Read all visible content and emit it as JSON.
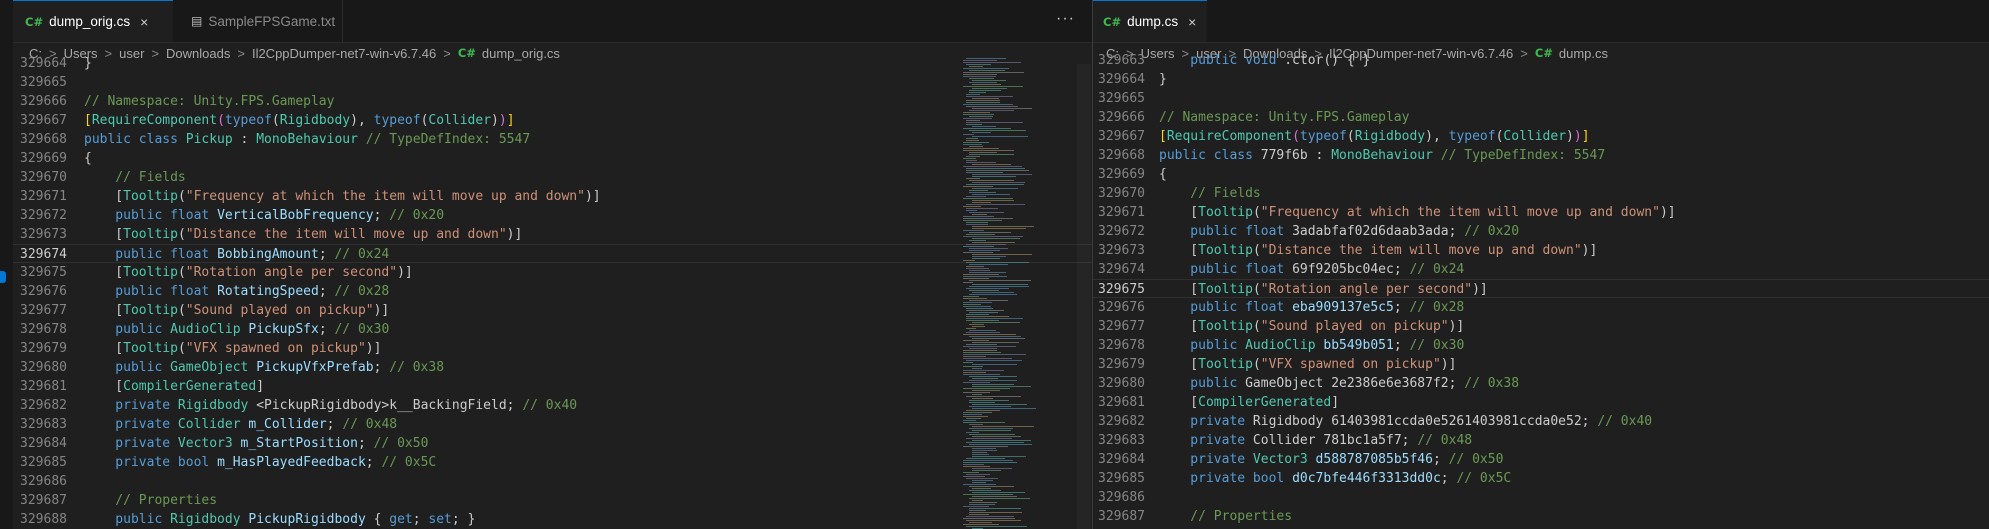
{
  "left": {
    "tabs": [
      {
        "label": "dump_orig.cs",
        "icon": "C#",
        "active": true,
        "close": "×"
      },
      {
        "label": "SampleFPSGame.txt",
        "icon": "file-icon",
        "active": false
      }
    ],
    "more": "···",
    "breadcrumb": [
      "C:",
      "Users",
      "user",
      "Downloads",
      "Il2CppDumper-net7-win-v6.7.46",
      "dump_orig.cs"
    ],
    "breadcrumb_sep": ">",
    "breadcrumb_icon": "C#",
    "current_line": "329674",
    "lines": [
      {
        "n": "329664",
        "t": [
          [
            "}",
            "pl"
          ]
        ]
      },
      {
        "n": "329665",
        "t": []
      },
      {
        "n": "329666",
        "t": [
          [
            "// Namespace: Unity.FPS.Gameplay",
            "cm"
          ]
        ]
      },
      {
        "n": "329667",
        "t": [
          [
            "[",
            "br"
          ],
          [
            "RequireComponent",
            "ty"
          ],
          [
            "(",
            "br2"
          ],
          [
            "typeof",
            "kw"
          ],
          [
            "(",
            "pl"
          ],
          [
            "Rigidbody",
            "ty"
          ],
          [
            "), ",
            "pl"
          ],
          [
            "typeof",
            "kw"
          ],
          [
            "(",
            "pl"
          ],
          [
            "Collider",
            "ty"
          ],
          [
            ")",
            "pl"
          ],
          [
            ")",
            "br2"
          ],
          [
            "]",
            "br"
          ]
        ]
      },
      {
        "n": "329668",
        "t": [
          [
            "public class ",
            "kw"
          ],
          [
            "Pickup",
            "ty"
          ],
          [
            " : ",
            "pl"
          ],
          [
            "MonoBehaviour",
            "ty"
          ],
          [
            " // TypeDefIndex: 5547",
            "cm"
          ]
        ]
      },
      {
        "n": "329669",
        "t": [
          [
            "{",
            "pl"
          ]
        ]
      },
      {
        "n": "329670",
        "t": [
          [
            "    // Fields",
            "cm"
          ]
        ]
      },
      {
        "n": "329671",
        "t": [
          [
            "    [",
            "pl"
          ],
          [
            "Tooltip",
            "ty"
          ],
          [
            "(",
            "pl"
          ],
          [
            "\"Frequency at which the item will move up and down\"",
            "st"
          ],
          [
            ")]",
            "pl"
          ]
        ]
      },
      {
        "n": "329672",
        "t": [
          [
            "    public float ",
            "kw"
          ],
          [
            "VerticalBobFrequency",
            "id"
          ],
          [
            "; ",
            "pl"
          ],
          [
            "// 0x20",
            "cm"
          ]
        ]
      },
      {
        "n": "329673",
        "t": [
          [
            "    [",
            "pl"
          ],
          [
            "Tooltip",
            "ty"
          ],
          [
            "(",
            "pl"
          ],
          [
            "\"Distance the item will move up and down\"",
            "st"
          ],
          [
            ")]",
            "pl"
          ]
        ]
      },
      {
        "n": "329674",
        "t": [
          [
            "    public float ",
            "kw"
          ],
          [
            "BobbingAmount",
            "id"
          ],
          [
            "; ",
            "pl"
          ],
          [
            "// 0x24",
            "cm"
          ]
        ]
      },
      {
        "n": "329675",
        "t": [
          [
            "    [",
            "pl"
          ],
          [
            "Tooltip",
            "ty"
          ],
          [
            "(",
            "pl"
          ],
          [
            "\"Rotation angle per second\"",
            "st"
          ],
          [
            ")]",
            "pl"
          ]
        ]
      },
      {
        "n": "329676",
        "t": [
          [
            "    public float ",
            "kw"
          ],
          [
            "RotatingSpeed",
            "id"
          ],
          [
            "; ",
            "pl"
          ],
          [
            "// 0x28",
            "cm"
          ]
        ]
      },
      {
        "n": "329677",
        "t": [
          [
            "    [",
            "pl"
          ],
          [
            "Tooltip",
            "ty"
          ],
          [
            "(",
            "pl"
          ],
          [
            "\"Sound played on pickup\"",
            "st"
          ],
          [
            ")]",
            "pl"
          ]
        ]
      },
      {
        "n": "329678",
        "t": [
          [
            "    public ",
            "kw"
          ],
          [
            "AudioClip ",
            "ty"
          ],
          [
            "PickupSfx",
            "id"
          ],
          [
            "; ",
            "pl"
          ],
          [
            "// 0x30",
            "cm"
          ]
        ]
      },
      {
        "n": "329679",
        "t": [
          [
            "    [",
            "pl"
          ],
          [
            "Tooltip",
            "ty"
          ],
          [
            "(",
            "pl"
          ],
          [
            "\"VFX spawned on pickup\"",
            "st"
          ],
          [
            ")]",
            "pl"
          ]
        ]
      },
      {
        "n": "329680",
        "t": [
          [
            "    public ",
            "kw"
          ],
          [
            "GameObject ",
            "ty"
          ],
          [
            "PickupVfxPrefab",
            "id"
          ],
          [
            "; ",
            "pl"
          ],
          [
            "// 0x38",
            "cm"
          ]
        ]
      },
      {
        "n": "329681",
        "t": [
          [
            "    [",
            "pl"
          ],
          [
            "CompilerGenerated",
            "ty"
          ],
          [
            "]",
            "pl"
          ]
        ]
      },
      {
        "n": "329682",
        "t": [
          [
            "    private ",
            "kw"
          ],
          [
            "Rigidbody ",
            "ty"
          ],
          [
            "<PickupRigidbody>k__BackingField",
            "pl"
          ],
          [
            "; ",
            "pl"
          ],
          [
            "// 0x40",
            "cm"
          ]
        ]
      },
      {
        "n": "329683",
        "t": [
          [
            "    private ",
            "kw"
          ],
          [
            "Collider ",
            "ty"
          ],
          [
            "m_Collider",
            "id"
          ],
          [
            "; ",
            "pl"
          ],
          [
            "// 0x48",
            "cm"
          ]
        ]
      },
      {
        "n": "329684",
        "t": [
          [
            "    private ",
            "kw"
          ],
          [
            "Vector3 ",
            "ty"
          ],
          [
            "m_StartPosition",
            "id"
          ],
          [
            "; ",
            "pl"
          ],
          [
            "// 0x50",
            "cm"
          ]
        ]
      },
      {
        "n": "329685",
        "t": [
          [
            "    private bool ",
            "kw"
          ],
          [
            "m_HasPlayedFeedback",
            "id"
          ],
          [
            "; ",
            "pl"
          ],
          [
            "// 0x5C",
            "cm"
          ]
        ]
      },
      {
        "n": "329686",
        "t": []
      },
      {
        "n": "329687",
        "t": [
          [
            "    // Properties",
            "cm"
          ]
        ]
      },
      {
        "n": "329688",
        "t": [
          [
            "    public ",
            "kw"
          ],
          [
            "Rigidbody ",
            "ty"
          ],
          [
            "PickupRigidbody",
            "id"
          ],
          [
            " { ",
            "pl"
          ],
          [
            "get",
            "kw"
          ],
          [
            "; ",
            "pl"
          ],
          [
            "set",
            "kw"
          ],
          [
            "; }",
            "pl"
          ]
        ]
      }
    ]
  },
  "right": {
    "tabs": [
      {
        "label": "dump.cs",
        "icon": "C#",
        "active": true,
        "close": "×"
      }
    ],
    "breadcrumb": [
      "C:",
      "Users",
      "user",
      "Downloads",
      "Il2CppDumper-net7-win-v6.7.46",
      "dump.cs"
    ],
    "breadcrumb_sep": ">",
    "breadcrumb_icon": "C#",
    "current_line": "329675",
    "lines": [
      {
        "n": "329663",
        "t": [
          [
            "    public void ",
            "kw"
          ],
          [
            ".ctor",
            "pl"
          ],
          [
            "() { }",
            "pl"
          ]
        ]
      },
      {
        "n": "329664",
        "t": [
          [
            "}",
            "pl"
          ]
        ]
      },
      {
        "n": "329665",
        "t": []
      },
      {
        "n": "329666",
        "t": [
          [
            "// Namespace: Unity.FPS.Gameplay",
            "cm"
          ]
        ]
      },
      {
        "n": "329667",
        "t": [
          [
            "[",
            "br"
          ],
          [
            "RequireComponent",
            "ty"
          ],
          [
            "(",
            "br2"
          ],
          [
            "typeof",
            "kw"
          ],
          [
            "(",
            "pl"
          ],
          [
            "Rigidbody",
            "ty"
          ],
          [
            "), ",
            "pl"
          ],
          [
            "typeof",
            "kw"
          ],
          [
            "(",
            "pl"
          ],
          [
            "Collider",
            "ty"
          ],
          [
            ")",
            "pl"
          ],
          [
            ")",
            "br2"
          ],
          [
            "]",
            "br"
          ]
        ]
      },
      {
        "n": "329668",
        "t": [
          [
            "public class ",
            "kw"
          ],
          [
            "779f6b",
            "pl"
          ],
          [
            " : ",
            "pl"
          ],
          [
            "MonoBehaviour",
            "ty"
          ],
          [
            " // TypeDefIndex: 5547",
            "cm"
          ]
        ]
      },
      {
        "n": "329669",
        "t": [
          [
            "{",
            "pl"
          ]
        ]
      },
      {
        "n": "329670",
        "t": [
          [
            "    // Fields",
            "cm"
          ]
        ]
      },
      {
        "n": "329671",
        "t": [
          [
            "    [",
            "pl"
          ],
          [
            "Tooltip",
            "ty"
          ],
          [
            "(",
            "pl"
          ],
          [
            "\"Frequency at which the item will move up and down\"",
            "st"
          ],
          [
            ")]",
            "pl"
          ]
        ]
      },
      {
        "n": "329672",
        "t": [
          [
            "    public float ",
            "kw"
          ],
          [
            "3adabfaf02d6daab3ada",
            "pl"
          ],
          [
            "; ",
            "pl"
          ],
          [
            "// 0x20",
            "cm"
          ]
        ]
      },
      {
        "n": "329673",
        "t": [
          [
            "    [",
            "pl"
          ],
          [
            "Tooltip",
            "ty"
          ],
          [
            "(",
            "pl"
          ],
          [
            "\"Distance the item will move up and down\"",
            "st"
          ],
          [
            ")]",
            "pl"
          ]
        ]
      },
      {
        "n": "329674",
        "t": [
          [
            "    public float ",
            "kw"
          ],
          [
            "69f9205bc04ec",
            "pl"
          ],
          [
            "; ",
            "pl"
          ],
          [
            "// 0x24",
            "cm"
          ]
        ]
      },
      {
        "n": "329675",
        "t": [
          [
            "    [",
            "pl"
          ],
          [
            "Tooltip",
            "ty"
          ],
          [
            "(",
            "pl"
          ],
          [
            "\"Rotation angle per second\"",
            "st"
          ],
          [
            ")]",
            "pl"
          ]
        ]
      },
      {
        "n": "329676",
        "t": [
          [
            "    public float ",
            "kw"
          ],
          [
            "eba909137e5c5",
            "id"
          ],
          [
            "; ",
            "pl"
          ],
          [
            "// 0x28",
            "cm"
          ]
        ]
      },
      {
        "n": "329677",
        "t": [
          [
            "    [",
            "pl"
          ],
          [
            "Tooltip",
            "ty"
          ],
          [
            "(",
            "pl"
          ],
          [
            "\"Sound played on pickup\"",
            "st"
          ],
          [
            ")]",
            "pl"
          ]
        ]
      },
      {
        "n": "329678",
        "t": [
          [
            "    public ",
            "kw"
          ],
          [
            "AudioClip ",
            "ty"
          ],
          [
            "bb549b051",
            "id"
          ],
          [
            "; ",
            "pl"
          ],
          [
            "// 0x30",
            "cm"
          ]
        ]
      },
      {
        "n": "329679",
        "t": [
          [
            "    [",
            "pl"
          ],
          [
            "Tooltip",
            "ty"
          ],
          [
            "(",
            "pl"
          ],
          [
            "\"VFX spawned on pickup\"",
            "st"
          ],
          [
            ")]",
            "pl"
          ]
        ]
      },
      {
        "n": "329680",
        "t": [
          [
            "    public ",
            "kw"
          ],
          [
            "GameObject ",
            "pl"
          ],
          [
            "2e2386e6e3687f2",
            "pl"
          ],
          [
            "; ",
            "pl"
          ],
          [
            "// 0x38",
            "cm"
          ]
        ]
      },
      {
        "n": "329681",
        "t": [
          [
            "    [",
            "pl"
          ],
          [
            "CompilerGenerated",
            "ty"
          ],
          [
            "]",
            "pl"
          ]
        ]
      },
      {
        "n": "329682",
        "t": [
          [
            "    private ",
            "kw"
          ],
          [
            "Rigidbody ",
            "pl"
          ],
          [
            "61403981ccda0e5261403981ccda0e52",
            "pl"
          ],
          [
            "; ",
            "pl"
          ],
          [
            "// 0x40",
            "cm"
          ]
        ]
      },
      {
        "n": "329683",
        "t": [
          [
            "    private ",
            "kw"
          ],
          [
            "Collider ",
            "pl"
          ],
          [
            "781bc1a5f7",
            "pl"
          ],
          [
            "; ",
            "pl"
          ],
          [
            "// 0x48",
            "cm"
          ]
        ]
      },
      {
        "n": "329684",
        "t": [
          [
            "    private ",
            "kw"
          ],
          [
            "Vector3 ",
            "ty"
          ],
          [
            "d588787085b5f46",
            "id"
          ],
          [
            "; ",
            "pl"
          ],
          [
            "// 0x50",
            "cm"
          ]
        ]
      },
      {
        "n": "329685",
        "t": [
          [
            "    private bool ",
            "kw"
          ],
          [
            "d0c7bfe446f3313dd0c",
            "id"
          ],
          [
            "; ",
            "pl"
          ],
          [
            "// 0x5C",
            "cm"
          ]
        ]
      },
      {
        "n": "329686",
        "t": []
      },
      {
        "n": "329687",
        "t": [
          [
            "    // Properties",
            "cm"
          ]
        ]
      }
    ]
  },
  "colors": {
    "background": "#1f1f1f",
    "keyword": "#569cd6",
    "type": "#4ec9b0",
    "string": "#ce9178",
    "comment": "#6a9955",
    "identifier": "#9cdcfe",
    "accent": "#0078d4"
  }
}
